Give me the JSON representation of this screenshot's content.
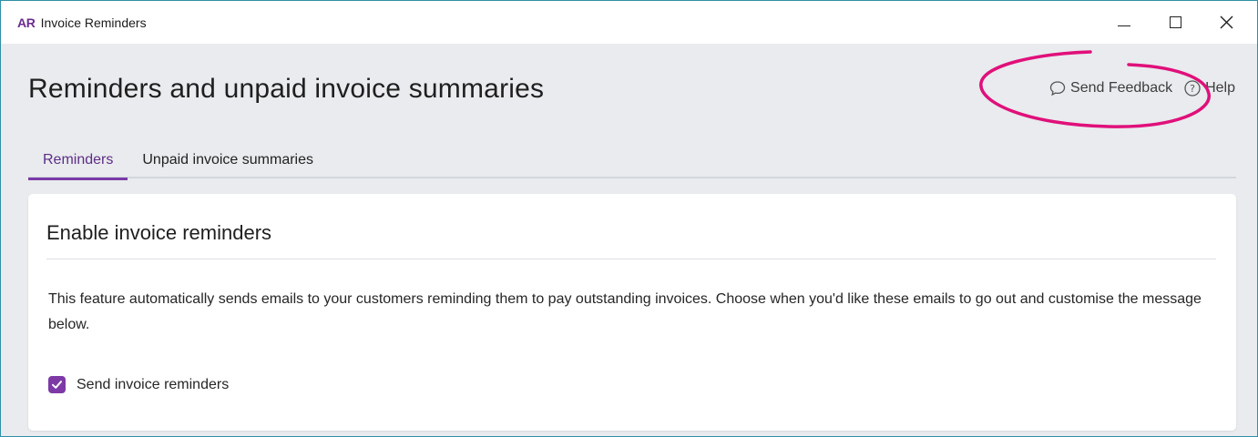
{
  "window": {
    "logo": "AR",
    "title": "Invoice Reminders"
  },
  "header": {
    "page_title": "Reminders and unpaid invoice summaries",
    "send_feedback_label": "Send Feedback",
    "help_label": "Help"
  },
  "tabs": [
    {
      "label": "Reminders",
      "active": true
    },
    {
      "label": "Unpaid invoice summaries",
      "active": false
    }
  ],
  "card": {
    "title": "Enable invoice reminders",
    "description": "This feature automatically sends emails to your customers reminding them to pay outstanding invoices. Choose when you'd like these emails to go out and customise the message below.",
    "checkbox_label": "Send invoice reminders",
    "checkbox_checked": true
  },
  "colors": {
    "accent": "#7c3aa8",
    "annotation": "#e0107a"
  }
}
